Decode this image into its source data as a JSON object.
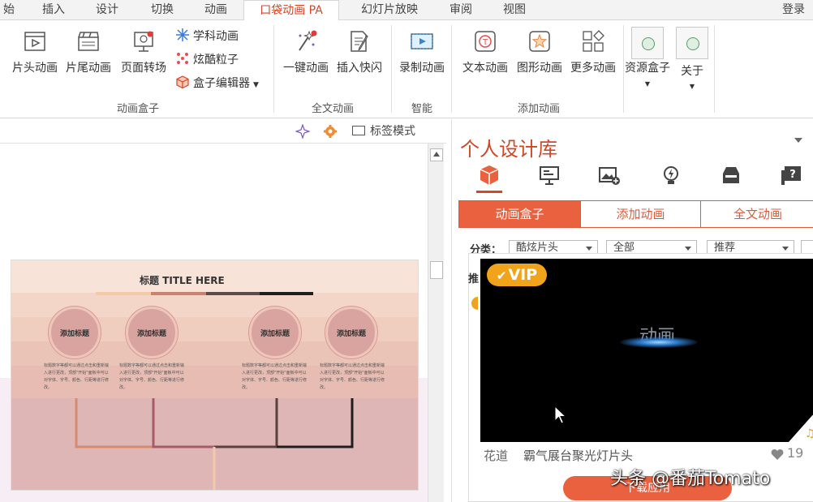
{
  "menubar": {
    "tabs": [
      "始",
      "插入",
      "设计",
      "切换",
      "动画",
      "口袋动画 PA",
      "幻灯片放映",
      "审阅",
      "视图"
    ],
    "active": "口袋动画 PA",
    "login": "登录"
  },
  "ribbon": {
    "buttons": {
      "intro": "片头动画",
      "outro": "片尾动画",
      "transition": "页面转场",
      "one_click": "一键动画",
      "flash": "插入快闪",
      "record": "录制动画",
      "text_anim": "文本动画",
      "shape_anim": "图形动画",
      "more_anim": "更多动画",
      "resource": "资源盒子",
      "about": "关于"
    },
    "small_buttons": {
      "subject": "学科动画",
      "particles": "炫酷粒子",
      "box_editor": "盒子编辑器"
    },
    "groups": {
      "anim_box": "动画盒子",
      "full_text": "全文动画",
      "smart": "智能",
      "add_anim": "添加动画"
    }
  },
  "editor": {
    "tag_mode": "标签模式"
  },
  "slide": {
    "title": "标题 TITLE HERE",
    "circle_label": "添加标题",
    "body_text": "标题数字等都可以通过点击和重新输入进行更改，顶部\"开始\"面板中可以对字体、字号、颜色、行距等进行修改。"
  },
  "panel": {
    "title": "个人设计库",
    "segments": [
      "动画盒子",
      "添加动画",
      "全文动画"
    ],
    "filter_label": "分类：",
    "filters": [
      "酷炫片头",
      "全部",
      "推荐"
    ],
    "card": {
      "badge": "VIP",
      "preview_text": "动画",
      "author": "花道",
      "name": "霸气展台聚光灯片头",
      "likes": "19",
      "apply": "下载应用"
    }
  },
  "watermark": "头条 @番茄Tomato",
  "colors": {
    "accent": "#d24726",
    "orange": "#e9613f",
    "vip": "#f2a31c"
  }
}
